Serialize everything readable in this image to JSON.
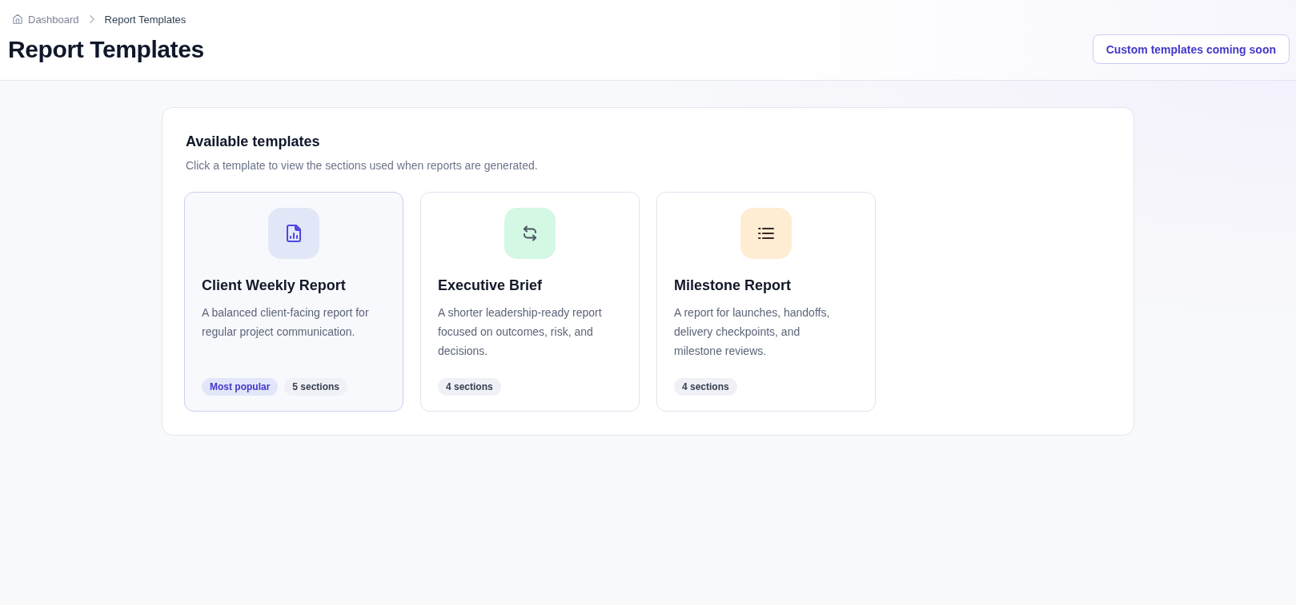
{
  "breadcrumb": [
    {
      "label": "Dashboard",
      "current": false
    },
    {
      "label": "Report Templates",
      "current": true
    }
  ],
  "page_title": "Report Templates",
  "header_button": {
    "label": "Custom templates coming soon"
  },
  "panel": {
    "title": "Available templates",
    "subtitle": "Click a template to view the sections used when reports are generated.",
    "templates": [
      {
        "kind": "document-chart",
        "color": "#e2e7f7",
        "title": "Client Weekly Report",
        "description": "A balanced client-facing report for regular project communication.",
        "selected": true,
        "badges": [
          {
            "kind": "highlight",
            "label": "Most popular"
          },
          {
            "kind": "count",
            "label": "5 sections"
          }
        ]
      },
      {
        "kind": "cycle",
        "color": "#d3f8e4",
        "title": "Executive Brief",
        "description": "A shorter leadership-ready report focused on outcomes, risk, and decisions.",
        "selected": false,
        "badges": [
          {
            "kind": "count",
            "label": "4 sections"
          }
        ]
      },
      {
        "kind": "list",
        "color": "#feedd3",
        "title": "Milestone Report",
        "description": "A report for launches, handoffs, delivery checkpoints, and milestone reviews.",
        "selected": false,
        "badges": [
          {
            "kind": "count",
            "label": "4 sections"
          }
        ]
      }
    ]
  }
}
